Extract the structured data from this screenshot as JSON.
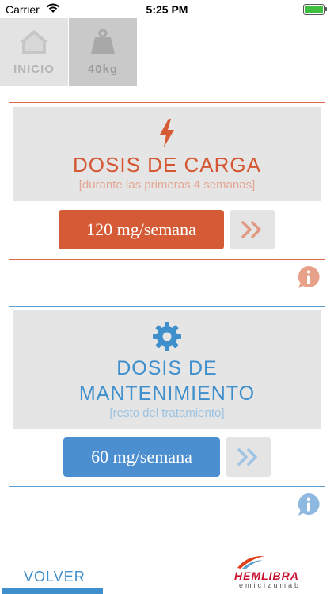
{
  "status_bar": {
    "carrier": "Carrier",
    "time": "5:25 PM"
  },
  "tabs": [
    {
      "label": "INICIO",
      "icon": "home-icon"
    },
    {
      "label": "40kg",
      "icon": "weight-icon"
    }
  ],
  "load_card": {
    "title": "DOSIS DE CARGA",
    "subtitle": "[durante las primeras 4 semanas]",
    "dose": "120 mg/semana",
    "icon": "lightning-icon",
    "accent": "#d55a36"
  },
  "maintenance_card": {
    "title_line1": "DOSIS DE",
    "title_line2": "MANTENIMIENTO",
    "subtitle": "[resto del tratamiento]",
    "dose": "60 mg/semana",
    "icon": "gear-icon",
    "accent": "#4b8fd1"
  },
  "footer": {
    "back_label": "VOLVER",
    "logo_name": "HEMLIBRA",
    "logo_sub": "emicizumab"
  }
}
